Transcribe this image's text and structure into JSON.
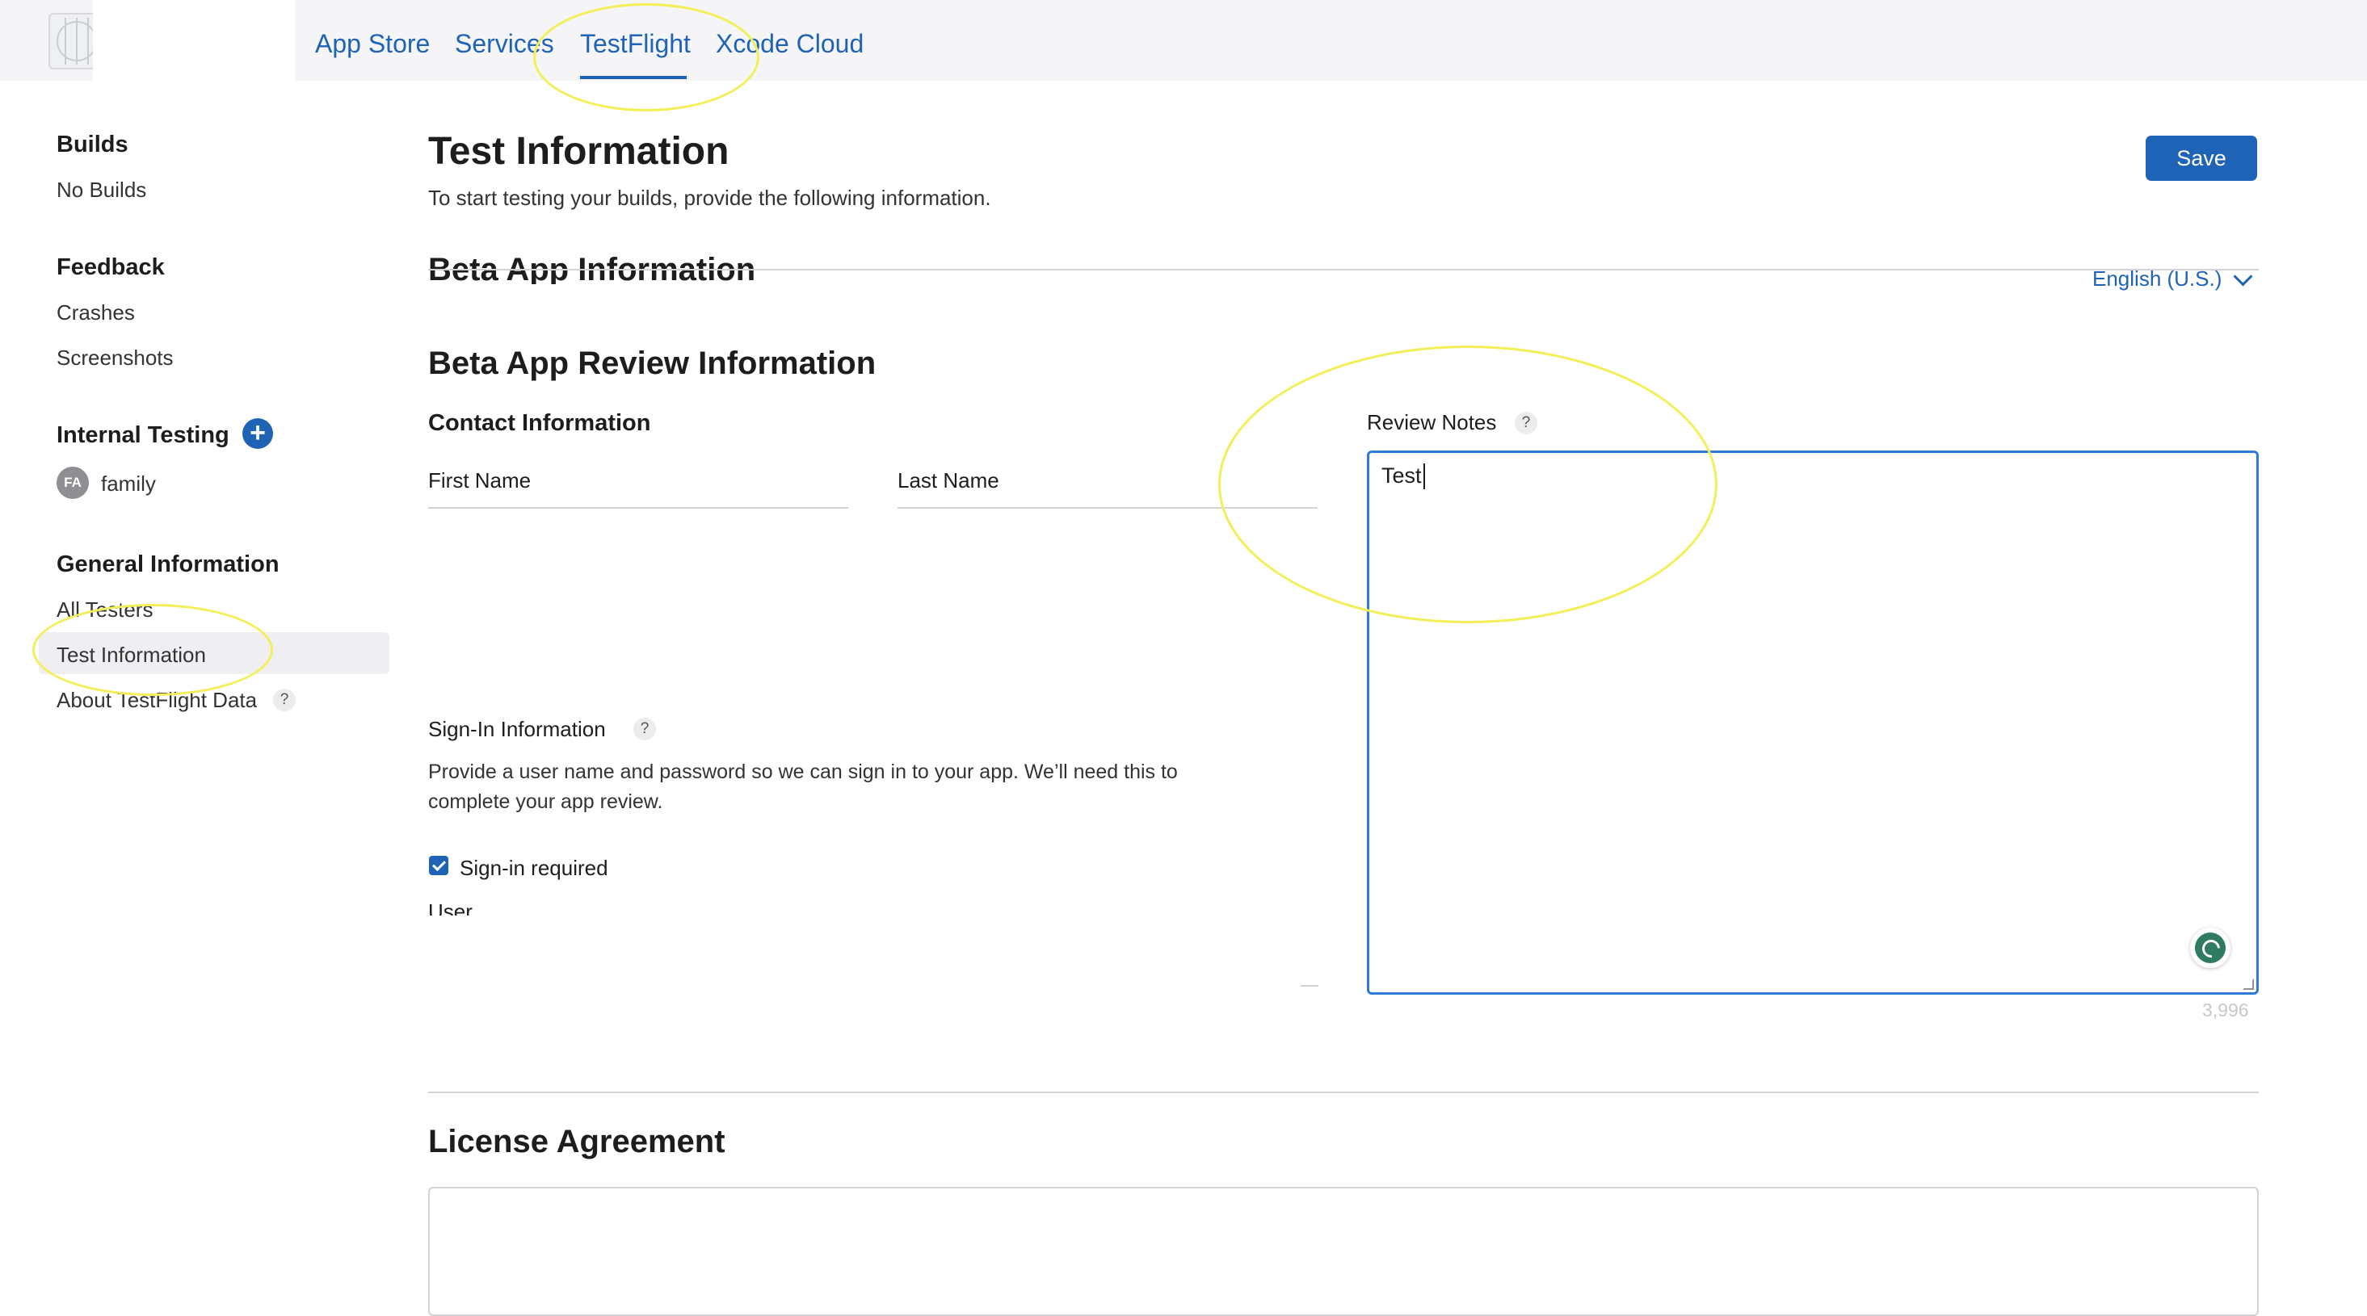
{
  "nav": {
    "items": [
      "App Store",
      "Services",
      "TestFlight",
      "Xcode Cloud"
    ],
    "active": "TestFlight"
  },
  "sidebar": {
    "builds_heading": "Builds",
    "builds_item": "No Builds",
    "feedback_heading": "Feedback",
    "feedback_items": [
      "Crashes",
      "Screenshots"
    ],
    "internal_heading": "Internal Testing",
    "group_avatar": "FA",
    "group_name": "family",
    "general_heading": "General Information",
    "general_items": [
      "All Testers",
      "Test Information",
      "About TestFlight Data"
    ],
    "selected": "Test Information"
  },
  "main": {
    "title": "Test Information",
    "subtitle": "To start testing your builds, provide the following information.",
    "save_label": "Save",
    "beta_app_info_heading": "Beta App Information",
    "language": "English (U.S.)",
    "review_heading": "Beta App Review Information",
    "contact_heading": "Contact Information",
    "first_name_label": "First Name",
    "last_name_label": "Last Name",
    "signin_heading": "Sign-In Information",
    "signin_description": "Provide a user name and password so we can sign in to your app. We’ll need this to complete your app review.",
    "signin_checkbox_label": "Sign-in required",
    "signin_checked": true,
    "username_label_partial": "User",
    "review_notes_label": "Review Notes",
    "review_notes_value": "Test",
    "review_notes_remaining": "3,996",
    "license_heading": "License Agreement"
  },
  "icons": {
    "help": "question-mark-icon",
    "add": "plus-icon",
    "dropdown": "chevron-down-icon",
    "grammar": "grammar-assistant-icon"
  },
  "colors": {
    "accent": "#1f63b7",
    "focus_border": "#2f79d8",
    "annotation": "#f3ef58"
  }
}
